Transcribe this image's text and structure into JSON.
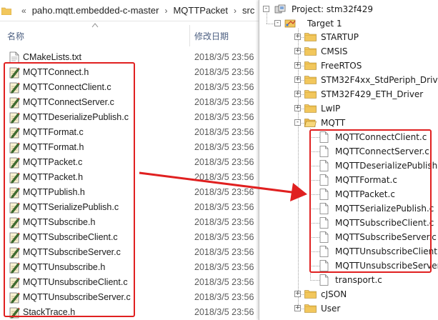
{
  "explorer": {
    "breadcrumb": [
      "paho.mqtt.embedded-c-master",
      "MQTTPacket",
      "src"
    ],
    "columns": {
      "name": "名称",
      "modified": "修改日期"
    },
    "files": [
      {
        "name": "CMakeLists.txt",
        "date": "2018/3/5 23:56",
        "type": "txt"
      },
      {
        "name": "MQTTConnect.h",
        "date": "2018/3/5 23:56",
        "type": "h"
      },
      {
        "name": "MQTTConnectClient.c",
        "date": "2018/3/5 23:56",
        "type": "c"
      },
      {
        "name": "MQTTConnectServer.c",
        "date": "2018/3/5 23:56",
        "type": "c"
      },
      {
        "name": "MQTTDeserializePublish.c",
        "date": "2018/3/5 23:56",
        "type": "c"
      },
      {
        "name": "MQTTFormat.c",
        "date": "2018/3/5 23:56",
        "type": "c"
      },
      {
        "name": "MQTTFormat.h",
        "date": "2018/3/5 23:56",
        "type": "h"
      },
      {
        "name": "MQTTPacket.c",
        "date": "2018/3/5 23:56",
        "type": "c"
      },
      {
        "name": "MQTTPacket.h",
        "date": "2018/3/5 23:56",
        "type": "h"
      },
      {
        "name": "MQTTPublish.h",
        "date": "2018/3/5 23:56",
        "type": "h"
      },
      {
        "name": "MQTTSerializePublish.c",
        "date": "2018/3/5 23:56",
        "type": "c"
      },
      {
        "name": "MQTTSubscribe.h",
        "date": "2018/3/5 23:56",
        "type": "h"
      },
      {
        "name": "MQTTSubscribeClient.c",
        "date": "2018/3/5 23:56",
        "type": "c"
      },
      {
        "name": "MQTTSubscribeServer.c",
        "date": "2018/3/5 23:56",
        "type": "c"
      },
      {
        "name": "MQTTUnsubscribe.h",
        "date": "2018/3/5 23:56",
        "type": "h"
      },
      {
        "name": "MQTTUnsubscribeClient.c",
        "date": "2018/3/5 23:56",
        "type": "c"
      },
      {
        "name": "MQTTUnsubscribeServer.c",
        "date": "2018/3/5 23:56",
        "type": "c"
      },
      {
        "name": "StackTrace.h",
        "date": "2018/3/5 23:56",
        "type": "h"
      }
    ]
  },
  "project": {
    "root": "Project: stm32f429",
    "target": "Target 1",
    "groups": [
      {
        "name": "STARTUP",
        "expanded": false
      },
      {
        "name": "CMSIS",
        "expanded": false
      },
      {
        "name": "FreeRTOS",
        "expanded": false
      },
      {
        "name": "STM32F4xx_StdPeriph_Driver",
        "expanded": false
      },
      {
        "name": "STM32F429_ETH_Driver",
        "expanded": false
      },
      {
        "name": "LwIP",
        "expanded": false
      },
      {
        "name": "MQTT",
        "expanded": true
      }
    ],
    "mqtt_files": [
      "MQTTConnectClient.c",
      "MQTTConnectServer.c",
      "MQTTDeserializePublish.c",
      "MQTTFormat.c",
      "MQTTPacket.c",
      "MQTTSerializePublish.c",
      "MQTTSubscribeClient.c",
      "MQTTSubscribeServer.c",
      "MQTTUnsubscribeClient.c",
      "MQTTUnsubscribeServer.c",
      "transport.c"
    ],
    "after_groups": [
      {
        "name": "cJSON",
        "expanded": false
      },
      {
        "name": "User",
        "expanded": false
      }
    ]
  },
  "colors": {
    "highlight": "#e02020",
    "folder": "#f2c75c"
  }
}
